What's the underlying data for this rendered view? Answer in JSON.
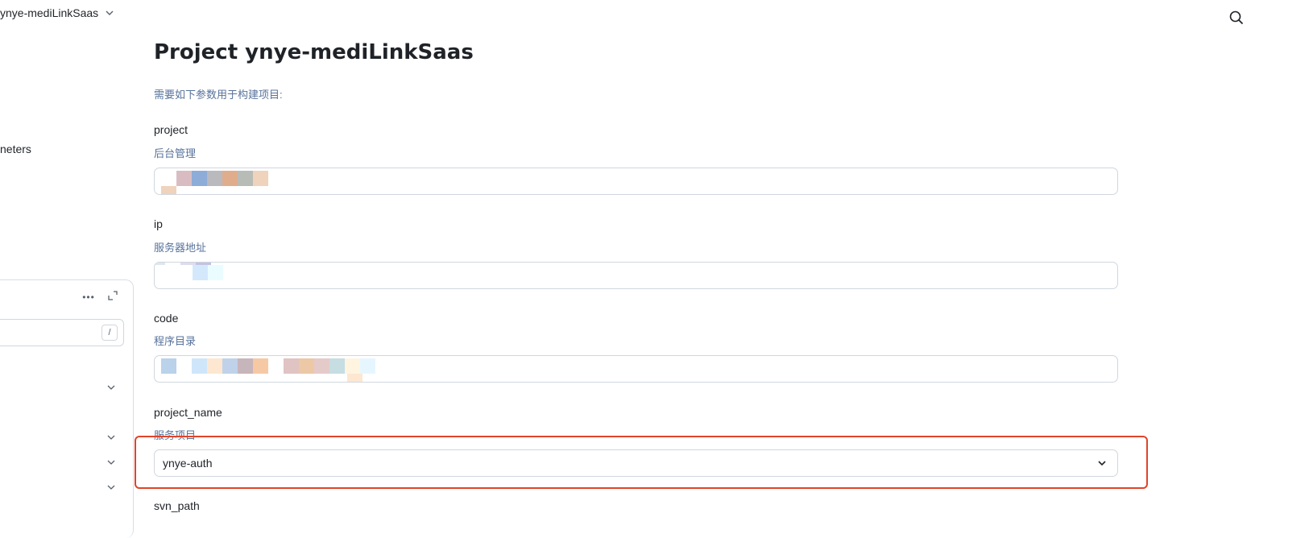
{
  "header": {
    "project_name": "ynye-mediLinkSaas",
    "search_icon": "search-icon",
    "dropdown_icon": "chevron-down-icon"
  },
  "sidebar": {
    "partial_label": "neters",
    "filter_shortcut": "/",
    "more_label": "•••"
  },
  "main": {
    "title": "Project ynye-mediLinkSaas",
    "intro": "需要如下参数用于构建项目:",
    "params": [
      {
        "name": "project",
        "description": "后台管理",
        "value": ""
      },
      {
        "name": "ip",
        "description": "服务器地址",
        "value": ""
      },
      {
        "name": "code",
        "description": "程序目录",
        "value": ""
      },
      {
        "name": "project_name",
        "description": "服务项目",
        "value": "ynye-auth"
      },
      {
        "name": "svn_path"
      }
    ]
  },
  "colors": {
    "accent_text": "#57729b",
    "highlight": "#e0442b",
    "border": "#d0d7de"
  }
}
